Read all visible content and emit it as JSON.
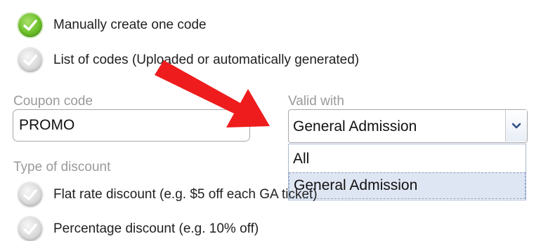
{
  "code_options": {
    "manual": {
      "label": "Manually create one code",
      "checked": true
    },
    "list": {
      "label": "List of codes (Uploaded or automatically generated)",
      "checked": false
    }
  },
  "coupon": {
    "label": "Coupon code",
    "value": "PROMO"
  },
  "valid_with": {
    "label": "Valid with",
    "selected": "General Admission",
    "options": [
      "All",
      "General Admission"
    ]
  },
  "discount": {
    "label": "Type of discount",
    "options": [
      {
        "label": "Flat rate discount (e.g. $5 off each GA ticket)",
        "checked": false
      },
      {
        "label": "Percentage discount (e.g. 10% off)",
        "checked": false
      }
    ]
  },
  "icons": {
    "checked_radio": "checkmark-icon",
    "unchecked_radio": "checkmark-icon",
    "select_arrow": "chevron-down-icon",
    "annotation": "red-arrow-icon"
  },
  "colors": {
    "checked_green": "#6cc02a",
    "annotation_red": "#ee1c1c",
    "selected_option": "#dfe6f3",
    "label_gray": "#9a9a9a"
  }
}
